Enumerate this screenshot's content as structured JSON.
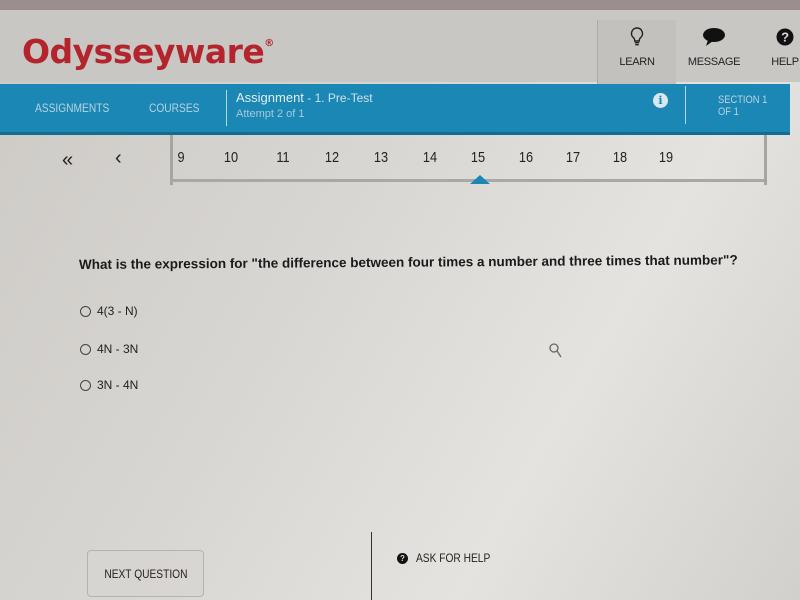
{
  "header": {
    "logo": "Odysseyware",
    "logo_mark": "®",
    "buttons": [
      {
        "label": "LEARN",
        "icon": "lightbulb-icon"
      },
      {
        "label": "MESSAGE",
        "icon": "speech-bubble-icon"
      },
      {
        "label": "HELP",
        "icon": "question-circle-icon"
      }
    ]
  },
  "nav": {
    "assignments": "ASSIGNMENTS",
    "courses": "COURSES",
    "assignment_title": "Assignment",
    "assignment_name": " - 1. Pre-Test",
    "attempt": "Attempt 2 of 1",
    "info_icon": "i",
    "section": "SECTION 1 OF 1"
  },
  "pager": {
    "first": "«",
    "prev": "‹",
    "pages": [
      "9",
      "10",
      "11",
      "12",
      "13",
      "14",
      "15",
      "16",
      "17",
      "18",
      "19"
    ],
    "current": "15"
  },
  "question": {
    "text": "What is the expression for \"the difference between four times a number and three times that number\"?",
    "options": [
      "4(3 - N)",
      "4N - 3N",
      "3N - 4N"
    ]
  },
  "footer": {
    "next_label": "NEXT QUESTION",
    "ask_help_label": "ASK FOR HELP",
    "ask_help_icon": "?"
  },
  "colors": {
    "brand": "#b3242c",
    "nav_blue": "#1b87b5"
  }
}
